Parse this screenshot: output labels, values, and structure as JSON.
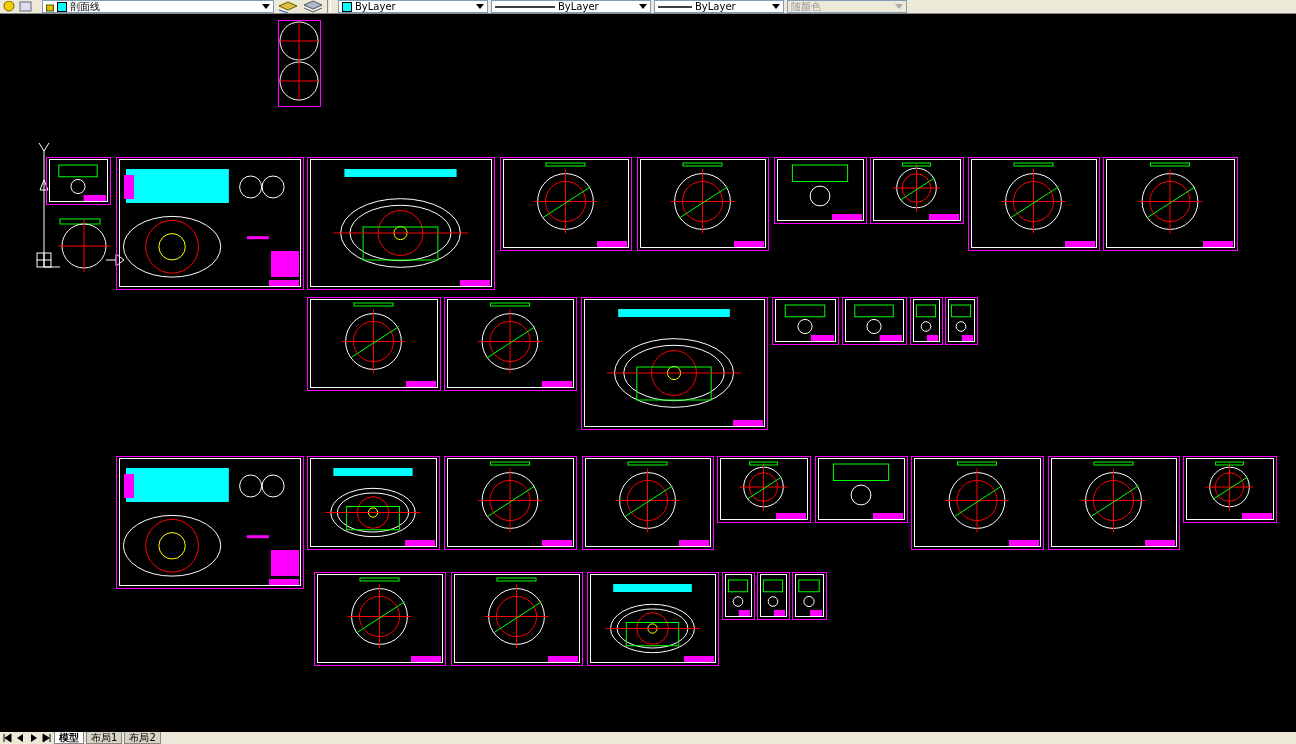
{
  "toolbar": {
    "layer": {
      "value": "剖面线"
    },
    "color": {
      "value": "ByLayer"
    },
    "linetype": {
      "value": "ByLayer"
    },
    "lineweight": {
      "value": "ByLayer"
    },
    "plot_style": {
      "value": "随颜色",
      "disabled": true
    }
  },
  "layout_tabs": [
    {
      "label": "模型",
      "selected": true
    },
    {
      "label": "布局1",
      "selected": false
    },
    {
      "label": "布局2",
      "selected": false
    }
  ]
}
